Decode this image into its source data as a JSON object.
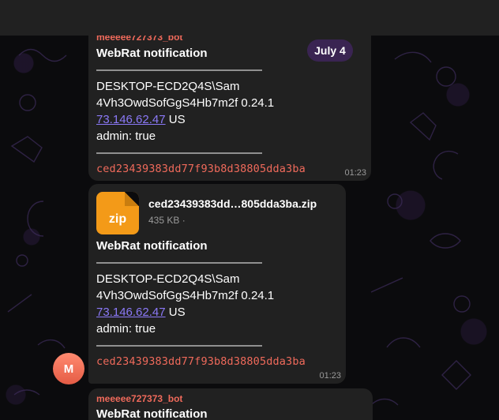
{
  "header": {
    "title": ""
  },
  "date_badge": "July 4",
  "messages": [
    {
      "sender": "meeeee727373_bot",
      "title": "WebRat notification",
      "divider": "——————————————",
      "host": "DESKTOP-ECD2Q4S\\Sam",
      "build": "4Vh3OwdSofGgS4Hb7m2f 0.24.1",
      "ip": "73.146.62.47",
      "country": "US",
      "admin": "admin: true",
      "divider2": "——————————————",
      "hash": "ced23439383dd77f93b8d38805dda3ba",
      "time": "01:23"
    },
    {
      "file_name": "ced23439383dd…805dda3ba.zip",
      "file_ext": "zip",
      "file_size": "435 KB ·",
      "title": "WebRat notification",
      "divider": "——————————————",
      "host": "DESKTOP-ECD2Q4S\\Sam",
      "build": "4Vh3OwdSofGgS4Hb7m2f 0.24.1",
      "ip": "73.146.62.47",
      "country": "US",
      "admin": "admin: true",
      "divider2": "——————————————",
      "hash": "ced23439383dd77f93b8d38805dda3ba",
      "time": "01:23"
    },
    {
      "sender": "meeeee727373_bot",
      "title": "WebRat notification"
    }
  ],
  "avatar": {
    "initial": "M",
    "color": "#ef6b55"
  },
  "colors": {
    "bubble": "#212121",
    "accent_link": "#8b79f7",
    "hash": "#f06a5b",
    "sender": "#f06a5b",
    "date_badge": "#3a2452"
  }
}
